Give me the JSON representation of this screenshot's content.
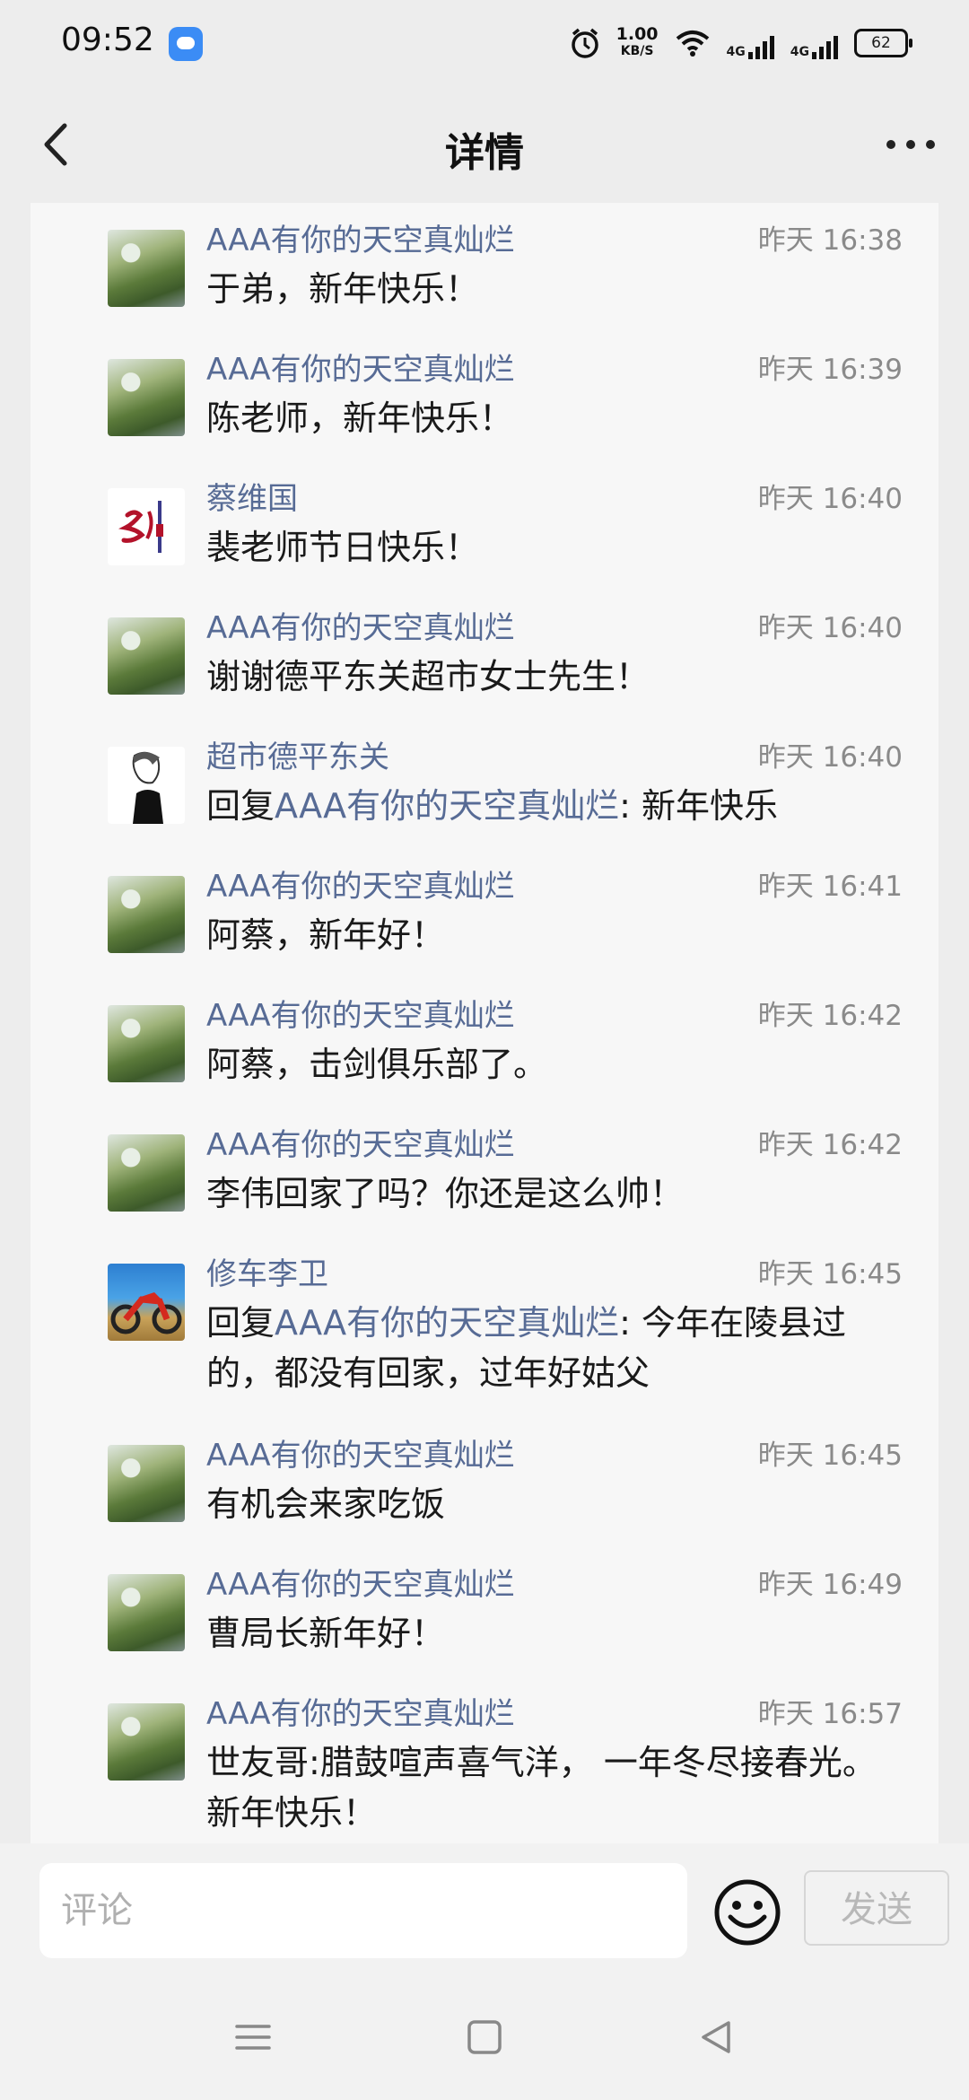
{
  "status_bar": {
    "time": "09:52",
    "net_speed_value": "1.00",
    "net_speed_unit": "KB/S",
    "sim1_label": "4G",
    "sim2_label": "4G",
    "battery": "62"
  },
  "header": {
    "title": "详情"
  },
  "comments": [
    {
      "name": "AAA有你的天空真灿烂",
      "time": "昨天 16:38",
      "reply_prefix": "",
      "reply_to": "",
      "reply_sep": "",
      "text": "于弟，新年快乐！",
      "avatar": "nature"
    },
    {
      "name": "AAA有你的天空真灿烂",
      "time": "昨天 16:39",
      "reply_prefix": "",
      "reply_to": "",
      "reply_sep": "",
      "text": "陈老师，新年快乐！",
      "avatar": "nature"
    },
    {
      "name": "蔡维国",
      "time": "昨天 16:40",
      "reply_prefix": "",
      "reply_to": "",
      "reply_sep": "",
      "text": "裴老师节日快乐！",
      "avatar": "art"
    },
    {
      "name": "AAA有你的天空真灿烂",
      "time": "昨天 16:40",
      "reply_prefix": "",
      "reply_to": "",
      "reply_sep": "",
      "text": "谢谢德平东关超市女士先生！",
      "avatar": "nature"
    },
    {
      "name": "超市德平东关",
      "time": "昨天 16:40",
      "reply_prefix": "回复",
      "reply_to": "AAA有你的天空真灿烂",
      "reply_sep": ": ",
      "text": "新年快乐",
      "avatar": "man"
    },
    {
      "name": "AAA有你的天空真灿烂",
      "time": "昨天 16:41",
      "reply_prefix": "",
      "reply_to": "",
      "reply_sep": "",
      "text": "阿蔡，新年好！",
      "avatar": "nature"
    },
    {
      "name": "AAA有你的天空真灿烂",
      "time": "昨天 16:42",
      "reply_prefix": "",
      "reply_to": "",
      "reply_sep": "",
      "text": "阿蔡，击剑俱乐部了。",
      "avatar": "nature"
    },
    {
      "name": "AAA有你的天空真灿烂",
      "time": "昨天 16:42",
      "reply_prefix": "",
      "reply_to": "",
      "reply_sep": "",
      "text": "李伟回家了吗？你还是这么帅！",
      "avatar": "nature"
    },
    {
      "name": "修车李卫",
      "time": "昨天 16:45",
      "reply_prefix": "回复",
      "reply_to": "AAA有你的天空真灿烂",
      "reply_sep": ": ",
      "text": "今年在陵县过的，都没有回家，过年好姑父",
      "avatar": "moto"
    },
    {
      "name": "AAA有你的天空真灿烂",
      "time": "昨天 16:45",
      "reply_prefix": "",
      "reply_to": "",
      "reply_sep": "",
      "text": "有机会来家吃饭",
      "avatar": "nature"
    },
    {
      "name": "AAA有你的天空真灿烂",
      "time": "昨天 16:49",
      "reply_prefix": "",
      "reply_to": "",
      "reply_sep": "",
      "text": "曹局长新年好！",
      "avatar": "nature"
    },
    {
      "name": "AAA有你的天空真灿烂",
      "time": "昨天 16:57",
      "reply_prefix": "",
      "reply_to": "",
      "reply_sep": "",
      "text": "世友哥:腊鼓喧声喜气洋， 一年冬尽接春光。新年快乐！",
      "avatar": "nature"
    }
  ],
  "input_bar": {
    "placeholder": "评论",
    "send_label": "发送"
  },
  "colors": {
    "name_link": "#576b95",
    "time_gray": "#8a8a8a",
    "background": "#ededed"
  }
}
